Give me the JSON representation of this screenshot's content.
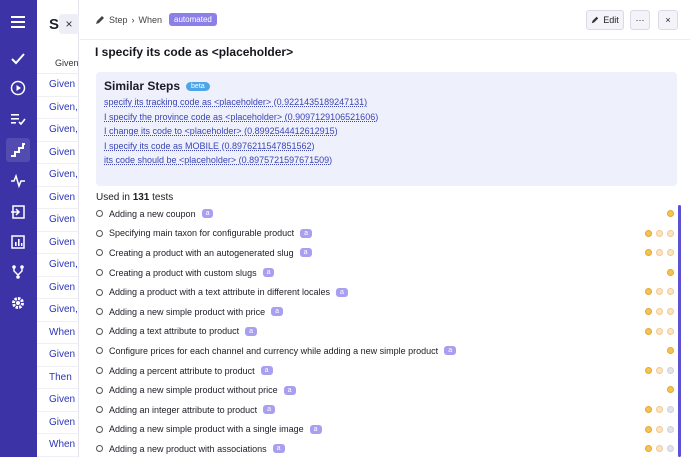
{
  "rail": {
    "icons": [
      "hamburger-icon",
      "check-icon",
      "play-icon",
      "checklist-icon",
      "steps-icon",
      "pulse-icon",
      "import-icon",
      "chart-icon",
      "branch-icon",
      "gear-icon"
    ]
  },
  "list": {
    "title": "Sy",
    "subheader": "Given",
    "keywords": [
      "Given",
      "Given,",
      "Given,",
      "Given",
      "Given,",
      "Given",
      "Given",
      "Given",
      "Given,",
      "Given",
      "Given,",
      "When",
      "Given",
      "Then",
      "Given",
      "Given",
      "When"
    ],
    "close_label": "×"
  },
  "topbar": {
    "crumb_step": "Step",
    "crumb_sep": "›",
    "crumb_when": "When",
    "automated_label": "automated",
    "edit_label": "Edit",
    "more_label": "···",
    "close_label": "×"
  },
  "step": {
    "title": "I specify its code as <placeholder>"
  },
  "similar": {
    "heading": "Similar Steps",
    "beta_label": "beta",
    "items": [
      "specify its tracking code as <placeholder> (0.9221435189247131)",
      "I specify the province code as <placeholder> (0.9097129106521606)",
      "I change its code to <placeholder> (0.8992544412612915)",
      "I specify its code as MOBILE (0.8976211547851562)",
      "its code should be <placeholder> (0.8975721597671509)"
    ]
  },
  "used": {
    "prefix": "Used in",
    "count": "131",
    "suffix": "tests"
  },
  "tests": [
    {
      "name": "Adding a new coupon",
      "badge": "a",
      "status": [
        "orange"
      ]
    },
    {
      "name": "Specifying main taxon for configurable product",
      "badge": "a",
      "status": [
        "orange",
        "pale",
        "pale"
      ]
    },
    {
      "name": "Creating a product with an autogenerated slug",
      "badge": "a",
      "status": [
        "orange",
        "pale",
        "pale"
      ]
    },
    {
      "name": "Creating a product with custom slugs",
      "badge": "a",
      "status": [
        "orange"
      ]
    },
    {
      "name": "Adding a product with a text attribute in different locales",
      "badge": "a",
      "status": [
        "orange",
        "pale",
        "pale"
      ]
    },
    {
      "name": "Adding a new simple product with price",
      "badge": "a",
      "status": [
        "orange",
        "pale",
        "pale"
      ]
    },
    {
      "name": "Adding a text attribute to product",
      "badge": "a",
      "status": [
        "orange",
        "pale",
        "pale"
      ]
    },
    {
      "name": "Configure prices for each channel and currency while adding a new simple product",
      "badge": "a",
      "status": [
        "orange"
      ]
    },
    {
      "name": "Adding a percent attribute to product",
      "badge": "a",
      "status": [
        "orange",
        "pale",
        "gray"
      ]
    },
    {
      "name": "Adding a new simple product without price",
      "badge": "a",
      "status": [
        "orange"
      ]
    },
    {
      "name": "Adding an integer attribute to product",
      "badge": "a",
      "status": [
        "orange",
        "pale",
        "gray"
      ]
    },
    {
      "name": "Adding a new simple product with a single image",
      "badge": "a",
      "status": [
        "orange",
        "pale",
        "gray"
      ]
    },
    {
      "name": "Adding a new product with associations",
      "badge": "a",
      "status": [
        "orange",
        "pale",
        "gray"
      ]
    }
  ],
  "colors": {
    "rail": "#3b33a6",
    "accent": "#8b80e8",
    "link": "#3b45b8",
    "status_orange": "#f3c35a",
    "status_pale": "#fbe3c3",
    "status_gray": "#e2e2ea"
  }
}
